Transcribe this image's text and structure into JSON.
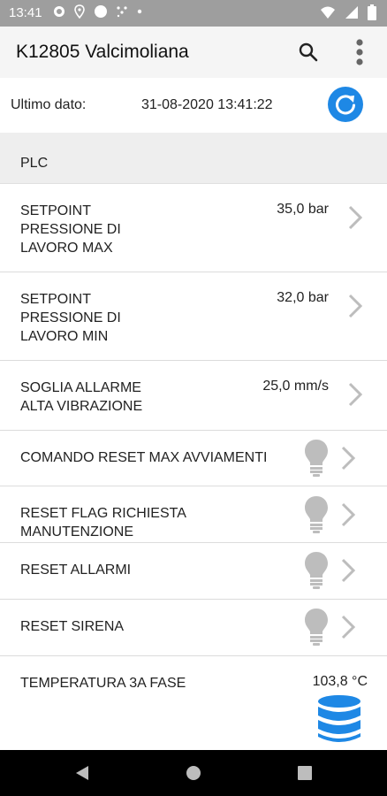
{
  "status": {
    "time": "13:41"
  },
  "appbar": {
    "title": "K12805 Valcimoliana"
  },
  "info": {
    "label": "Ultimo dato:",
    "value": "31-08-2020 13:41:22"
  },
  "section": {
    "label": "PLC"
  },
  "rows": [
    {
      "name": "SETPOINT\nPRESSIONE DI\nLAVORO MAX",
      "value": "35,0 bar"
    },
    {
      "name": "SETPOINT\nPRESSIONE DI\nLAVORO MIN",
      "value": "32,0 bar"
    },
    {
      "name": "SOGLIA ALLARME\nALTA VIBRAZIONE",
      "value": "25,0 mm/s"
    },
    {
      "name": "COMANDO RESET MAX AVVIAMENTI"
    },
    {
      "name": "RESET FLAG RICHIESTA\nMANUTENZIONE"
    },
    {
      "name": "RESET ALLARMI"
    },
    {
      "name": "RESET SIRENA"
    },
    {
      "name": "TEMPERATURA 3A FASE",
      "value": "103,8 °C"
    }
  ],
  "colors": {
    "accent": "#1e88e5",
    "statusbar": "#9e9e9e",
    "icon_gray": "#bdbdbd"
  },
  "icons": [
    "search-icon",
    "more-vert-icon",
    "refresh-icon",
    "chevron-right-icon",
    "lightbulb-icon",
    "database-icon"
  ]
}
